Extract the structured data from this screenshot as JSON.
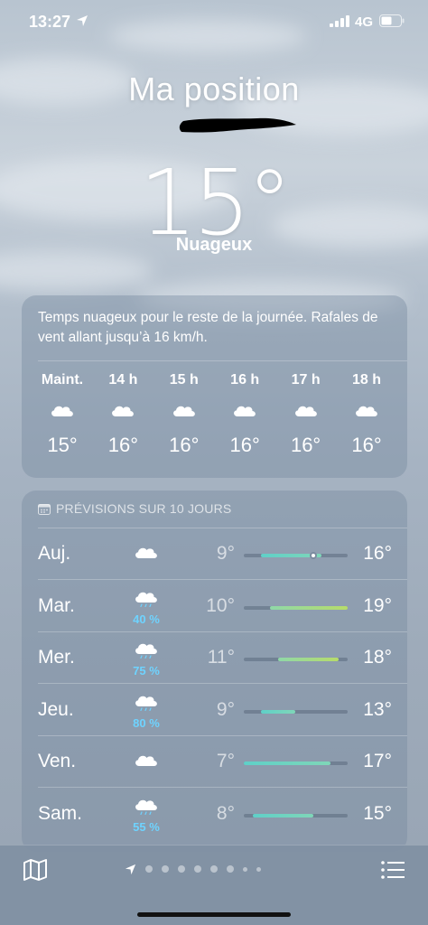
{
  "status_bar": {
    "time": "13:27",
    "network": "4G",
    "icons": [
      "location-arrow-icon",
      "signal-icon",
      "battery-icon"
    ]
  },
  "location": {
    "title": "Ma position"
  },
  "current": {
    "temperature": "15°",
    "condition": "Nuageux"
  },
  "hourly": {
    "summary": "Temps nuageux pour le reste de la journée. Rafales de vent allant jusqu’à 16 km/h.",
    "items": [
      {
        "label": "Maint.",
        "icon": "cloud-icon",
        "temp": "15°"
      },
      {
        "label": "14 h",
        "icon": "cloud-icon",
        "temp": "16°"
      },
      {
        "label": "15 h",
        "icon": "cloud-icon",
        "temp": "16°"
      },
      {
        "label": "16 h",
        "icon": "cloud-icon",
        "temp": "16°"
      },
      {
        "label": "17 h",
        "icon": "cloud-icon",
        "temp": "16°"
      },
      {
        "label": "18 h",
        "icon": "cloud-icon",
        "temp": "16°"
      }
    ]
  },
  "daily": {
    "header": "PRÉVISIONS SUR 10 JOURS",
    "range_min": 7,
    "range_max": 19,
    "items": [
      {
        "day": "Auj.",
        "icon": "cloud-icon",
        "precip": "",
        "low": "9°",
        "high": "16°",
        "low_v": 9,
        "high_v": 16,
        "current_v": 15
      },
      {
        "day": "Mar.",
        "icon": "cloud-rain-icon",
        "precip": "40 %",
        "low": "10°",
        "high": "19°",
        "low_v": 10,
        "high_v": 19
      },
      {
        "day": "Mer.",
        "icon": "cloud-rain-icon",
        "precip": "75 %",
        "low": "11°",
        "high": "18°",
        "low_v": 11,
        "high_v": 18
      },
      {
        "day": "Jeu.",
        "icon": "cloud-rain-icon",
        "precip": "80 %",
        "low": "9°",
        "high": "13°",
        "low_v": 9,
        "high_v": 13
      },
      {
        "day": "Ven.",
        "icon": "cloud-icon",
        "precip": "",
        "low": "7°",
        "high": "17°",
        "low_v": 7,
        "high_v": 17
      },
      {
        "day": "Sam.",
        "icon": "cloud-rain-icon",
        "precip": "55 %",
        "low": "8°",
        "high": "15°",
        "low_v": 8,
        "high_v": 15
      }
    ]
  },
  "toolbar": {
    "left_icon": "map-icon",
    "right_icon": "list-icon",
    "page_count": 9,
    "current_page": 0
  },
  "colors": {
    "bar_cool": "#5fd0c8",
    "bar_warm": "#b7dc6a",
    "precip": "#6ed3ff"
  }
}
